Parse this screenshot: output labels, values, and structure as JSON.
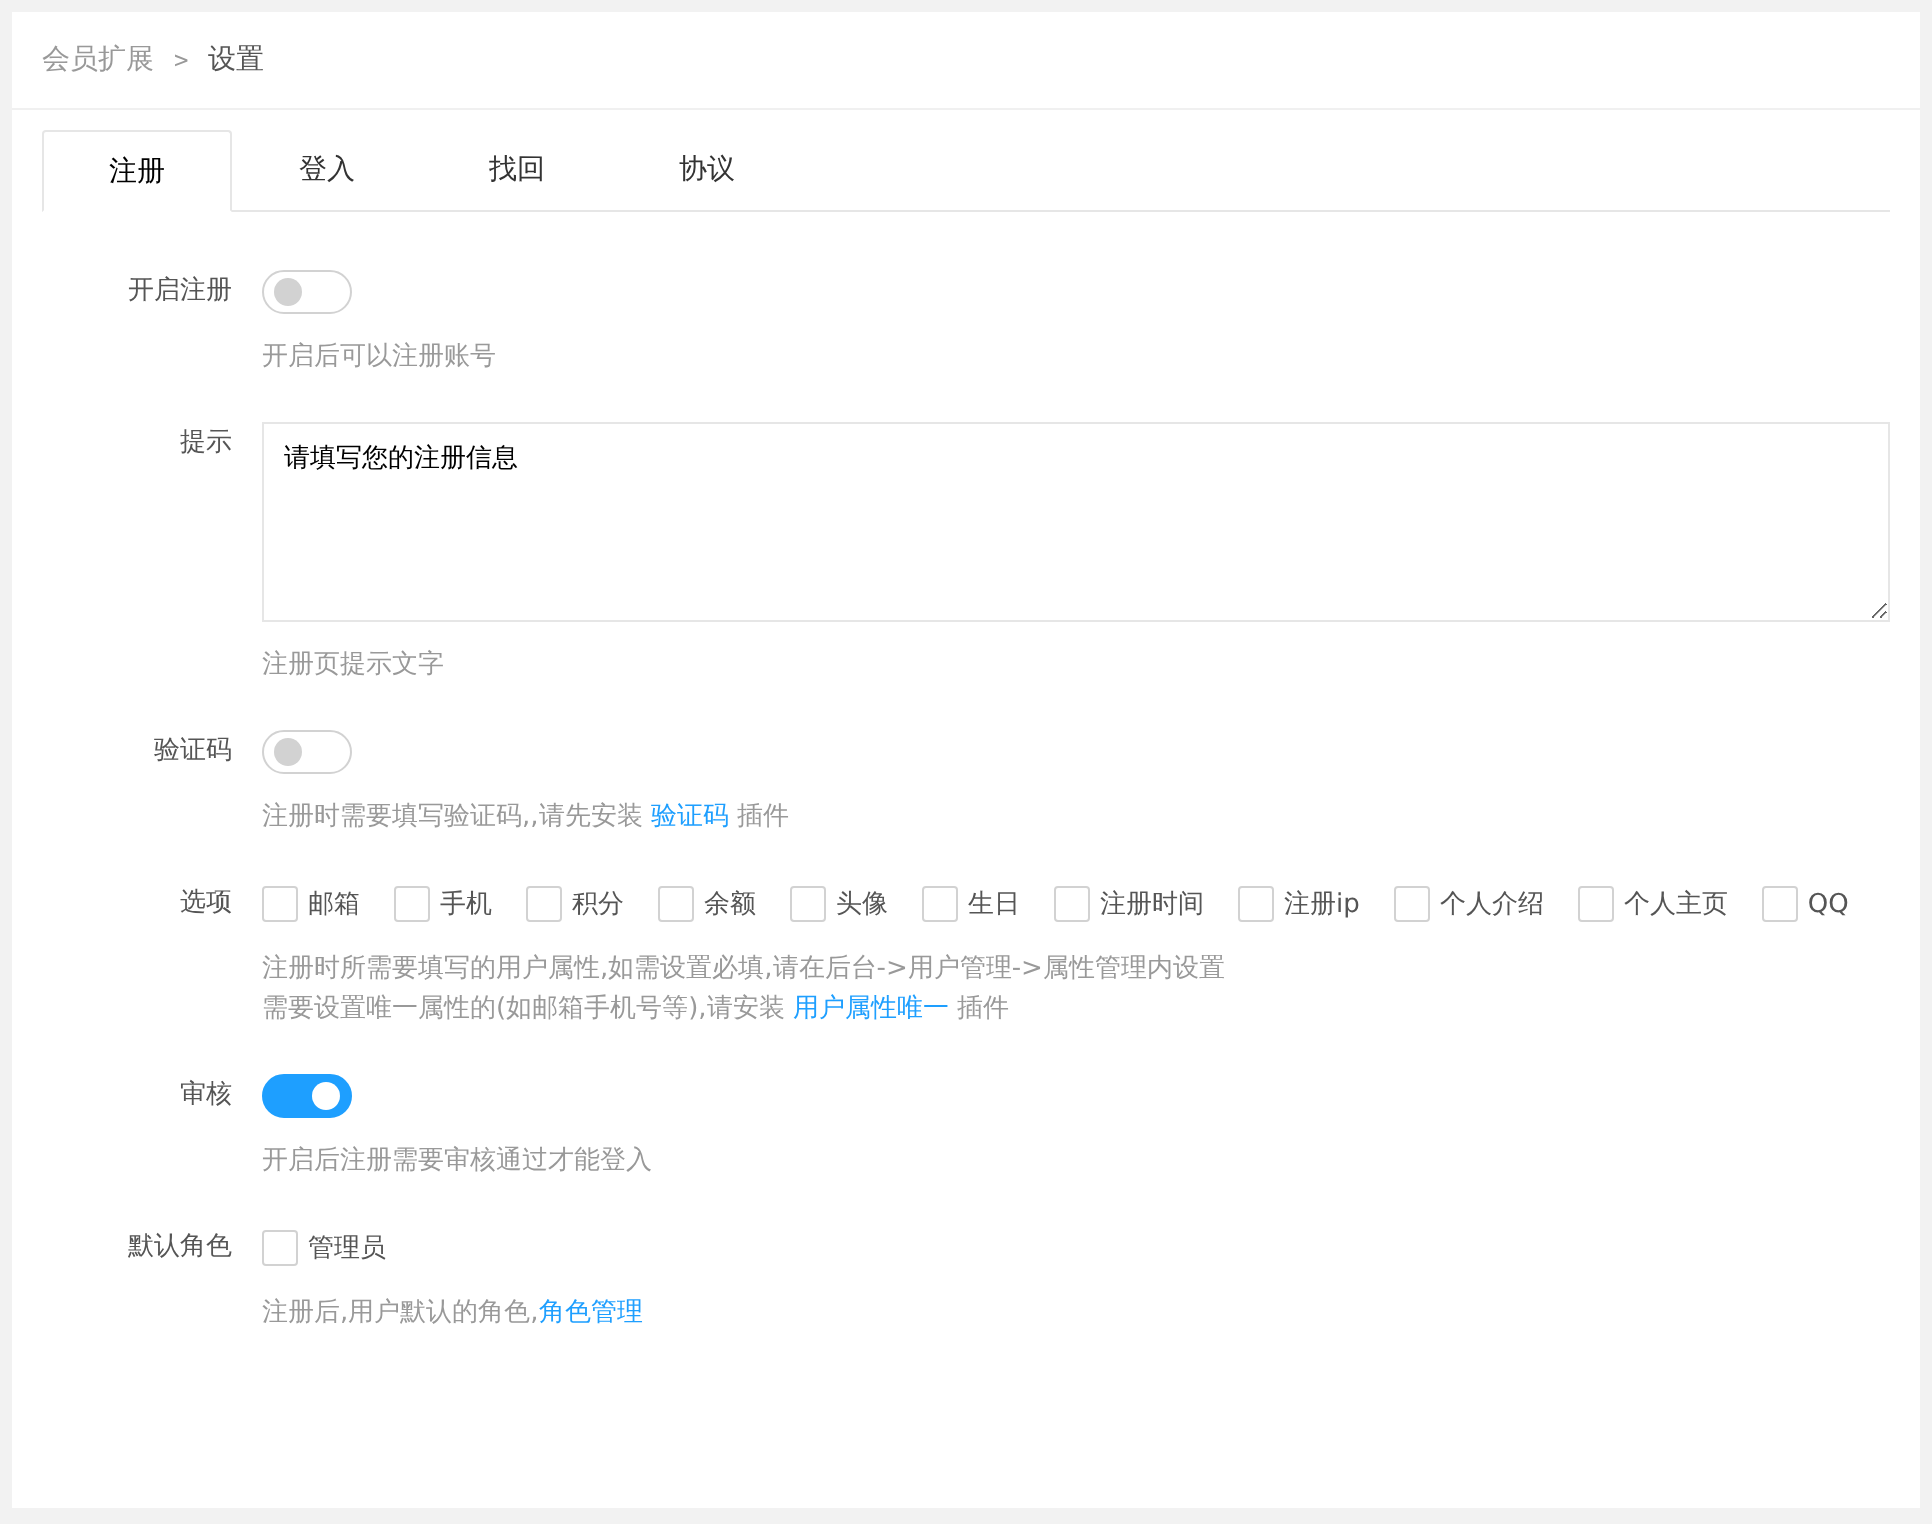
{
  "breadcrumb": [
    {
      "label": "会员扩展",
      "selected": false
    },
    {
      "label": ">",
      "kind": "separator"
    },
    {
      "label": "设置",
      "selected": true
    }
  ],
  "tabs": [
    {
      "label": "注册",
      "selected": true
    },
    {
      "label": "登入",
      "selected": false
    },
    {
      "label": "找回",
      "selected": false
    },
    {
      "label": "协议",
      "selected": false
    }
  ],
  "fields": [
    {
      "kind": "toggle",
      "label": "开启注册",
      "on": false,
      "help": [
        [
          {
            "text": "开启后可以注册账号"
          }
        ]
      ]
    },
    {
      "kind": "textarea",
      "label": "提示",
      "value": "请填写您的注册信息",
      "help": [
        [
          {
            "text": "注册页提示文字"
          }
        ]
      ]
    },
    {
      "kind": "toggle",
      "label": "验证码",
      "on": false,
      "help": [
        [
          {
            "text": "注册时需要填写验证码,,请先安装 "
          },
          {
            "text": "验证码",
            "link": true
          },
          {
            "text": " 插件"
          }
        ]
      ]
    },
    {
      "kind": "checkboxes",
      "label": "选项",
      "options": [
        {
          "label": "邮箱",
          "checked": false
        },
        {
          "label": "手机",
          "checked": false
        },
        {
          "label": "积分",
          "checked": false
        },
        {
          "label": "余额",
          "checked": false
        },
        {
          "label": "头像",
          "checked": false
        },
        {
          "label": "生日",
          "checked": false
        },
        {
          "label": "注册时间",
          "checked": false
        },
        {
          "label": "注册ip",
          "checked": false
        },
        {
          "label": "个人介绍",
          "checked": false
        },
        {
          "label": "个人主页",
          "checked": false
        },
        {
          "label": "QQ",
          "checked": false
        }
      ],
      "help": [
        [
          {
            "text": "注册时所需要填写的用户属性,如需设置必填,请在后台->用户管理->属性管理内设置"
          }
        ],
        [
          {
            "text": "需要设置唯一属性的(如邮箱手机号等),请安装 "
          },
          {
            "text": "用户属性唯一",
            "link": true
          },
          {
            "text": " 插件"
          }
        ]
      ]
    },
    {
      "kind": "toggle",
      "label": "审核",
      "on": true,
      "help": [
        [
          {
            "text": "开启后注册需要审核通过才能登入"
          }
        ]
      ]
    },
    {
      "kind": "checkboxes",
      "label": "默认角色",
      "options": [
        {
          "label": "管理员",
          "checked": false
        }
      ],
      "help": [
        [
          {
            "text": "注册后,用户默认的角色,"
          },
          {
            "text": "角色管理",
            "link": true
          }
        ]
      ]
    }
  ]
}
